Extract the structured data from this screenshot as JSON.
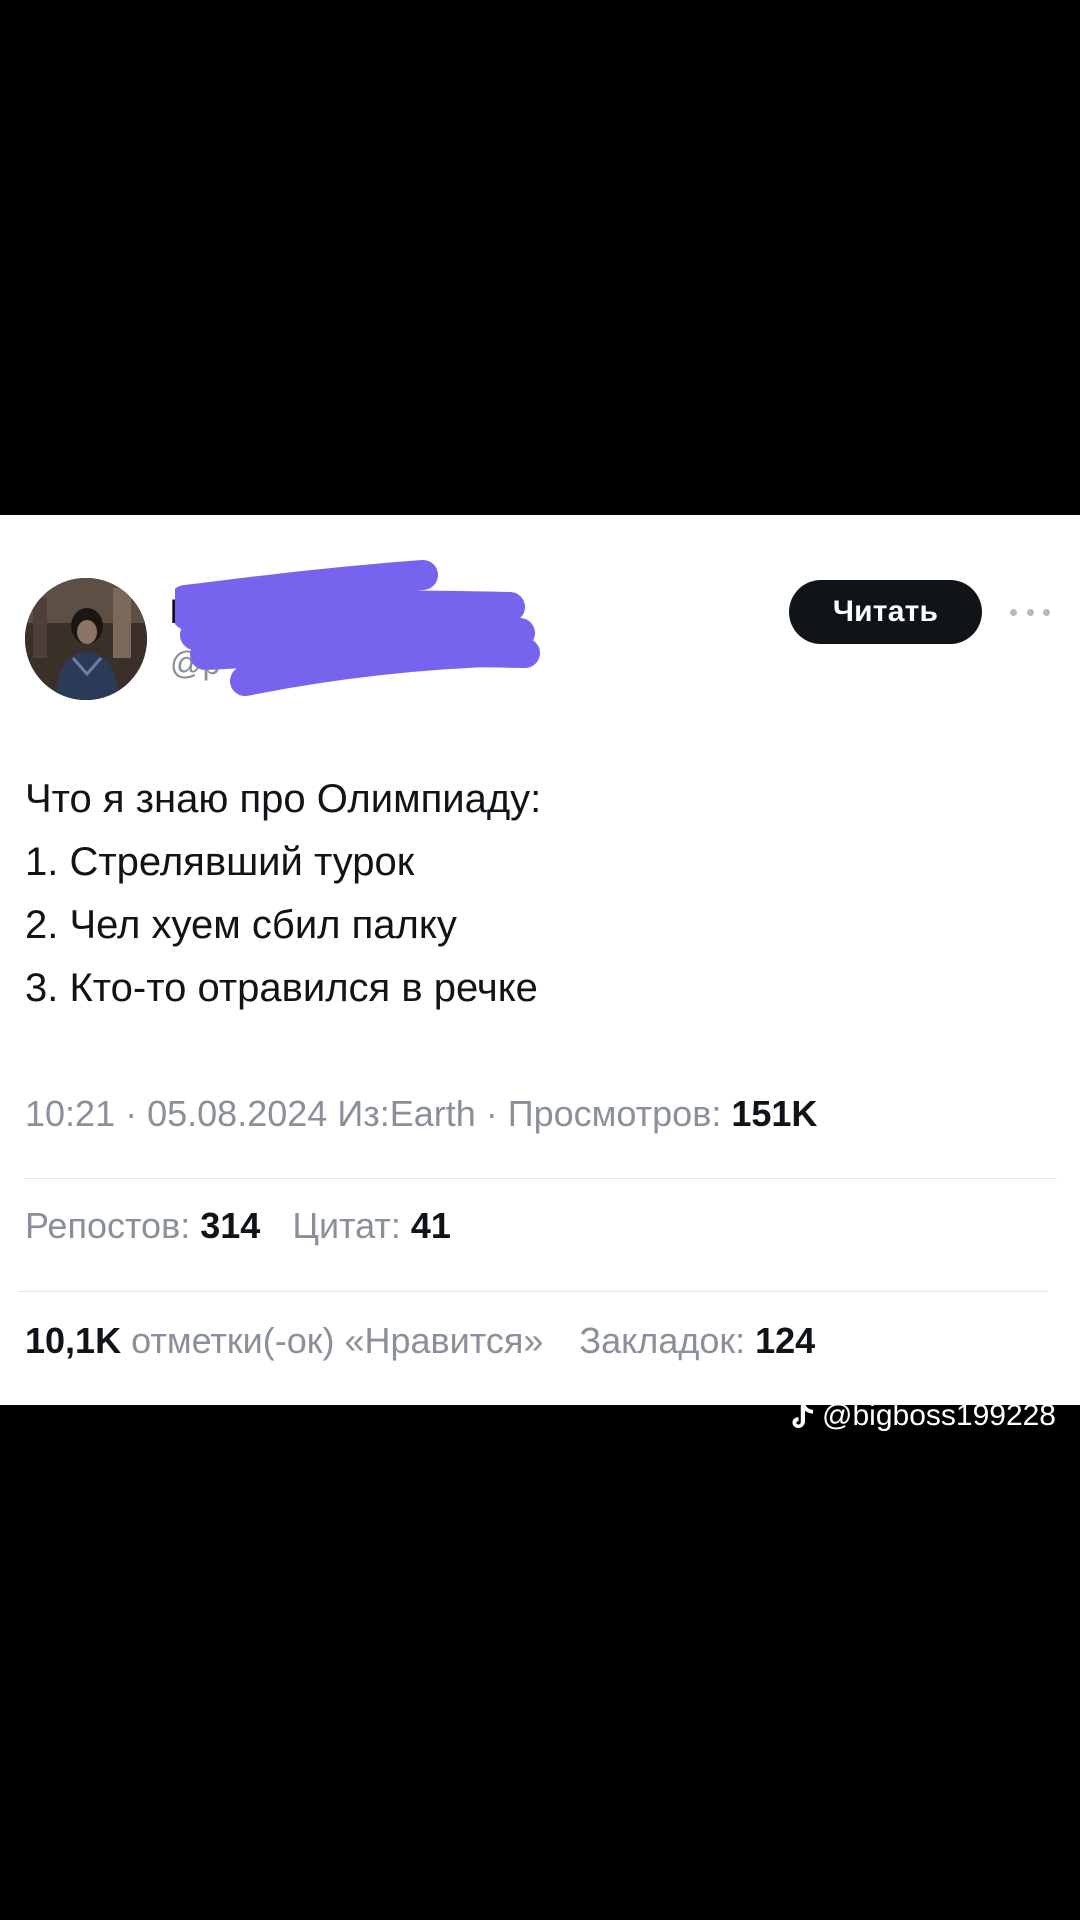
{
  "tweet": {
    "author_name_visible": "Г",
    "author_handle_visible": "@р",
    "follow_label": "Читать",
    "more_icon": "more-horizontal-icon",
    "lines": [
      "Что я знаю про Олимпиаду:",
      "1. Стрелявший турок",
      "2. Чел хуем сбил палку",
      "3. Кто-то отравился в речке"
    ],
    "meta": {
      "time": "10:21",
      "date": "05.08.2024",
      "source": "Из:Earth",
      "views_label": "Просмотров:",
      "views_value": "151K"
    },
    "stats": {
      "reposts_label": "Репостов:",
      "reposts_value": "314",
      "quotes_label": "Цитат:",
      "quotes_value": "41",
      "likes_value": "10,1K",
      "likes_label": "отметки(-ок) «Нравится»",
      "bookmarks_label": "Закладок:",
      "bookmarks_value": "124"
    },
    "scribble_color": "#7664ee"
  },
  "watermark": {
    "icon": "tiktok-icon",
    "handle": "@bigboss199228"
  }
}
